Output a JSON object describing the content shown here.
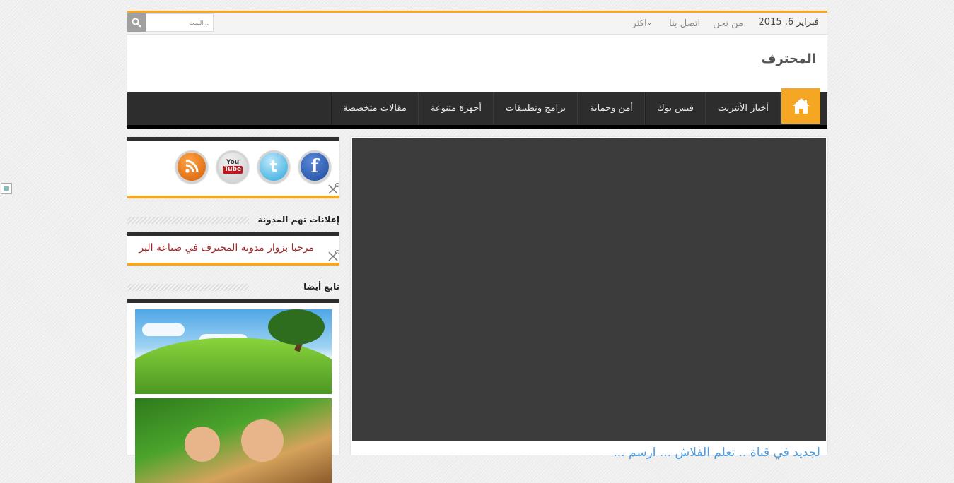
{
  "topbar": {
    "date": "فبراير 6, 2015",
    "links": [
      "من نحن",
      "اتصل بنا",
      "اكثر"
    ],
    "search_placeholder": "البحث..."
  },
  "header": {
    "site_title": "المحترف"
  },
  "nav": {
    "items": [
      "أخبار الأنترنت",
      "فيس بوك",
      "أمن وحماية",
      "برامج وتطبيقات",
      "أجهزة متنوعة",
      "مقالات متخصصة"
    ]
  },
  "sidebar": {
    "social": [
      "facebook-icon",
      "twitter-icon",
      "youtube-icon",
      "rss-icon"
    ],
    "youtube_you": "You",
    "youtube_tube": "Tube",
    "ads_title": "إعلانات تهم المدونة",
    "ads_text": "مرحبا بزوار مدونة المحترف في صناعة البر",
    "follow_title": "تابع أيضا"
  },
  "featured": {
    "caption": "لجديد في قناة .. تعلم الفلاش  ... ارسم ..."
  },
  "colors": {
    "accent": "#f5a623",
    "nav": "#2d2d2d",
    "link": "#4d9be0"
  }
}
